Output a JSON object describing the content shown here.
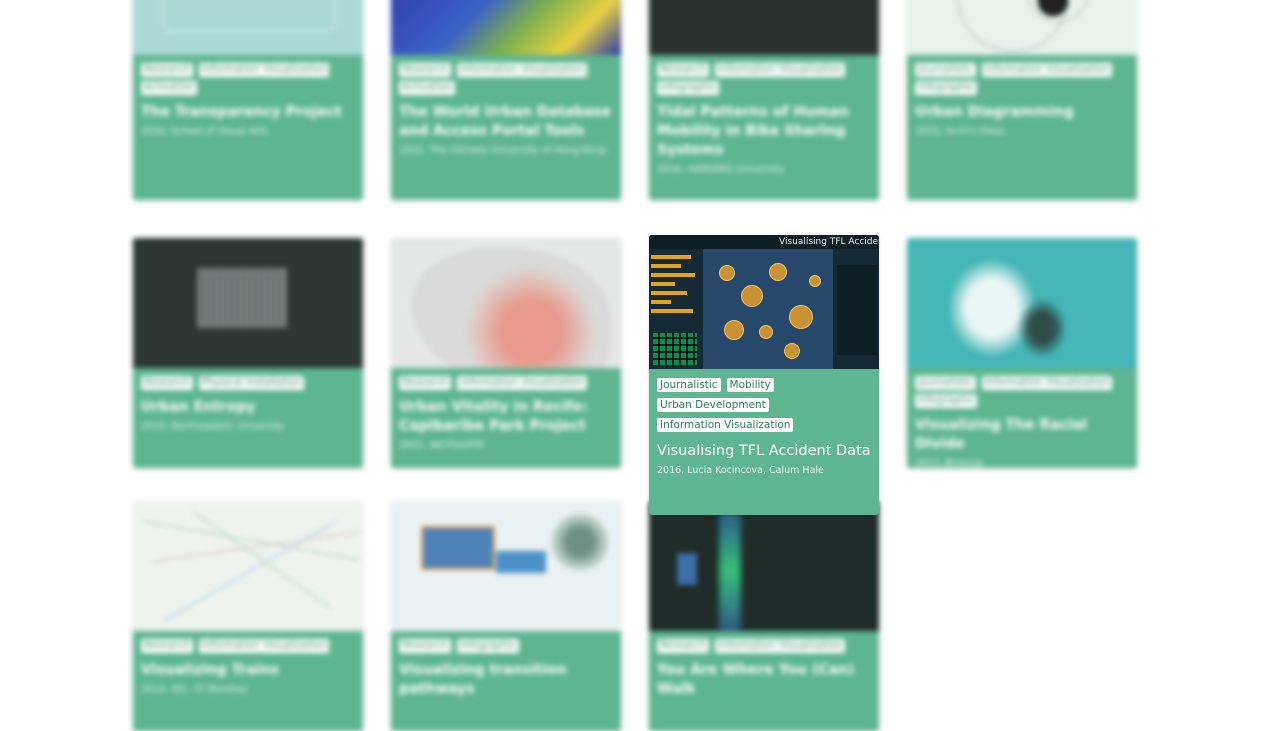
{
  "cards": [
    {
      "title": "The Transparency Project",
      "meta": "2016, School of Visual Arts",
      "tags": [
        "Research",
        "Information Visualization",
        "Activation"
      ]
    },
    {
      "title": "The World Urban Database and Access Portal Tools",
      "meta": "2015, The Chinese University of Hong Kong",
      "tags": [
        "Research",
        "Information Visualization",
        "Activation"
      ]
    },
    {
      "title": "Tidal Patterns of Human Mobility in Bike Sharing Systems",
      "meta": "2016, HARVARD University",
      "tags": [
        "Research",
        "Information Visualization",
        "Infographic"
      ]
    },
    {
      "title": "Urban Diagramming",
      "meta": "2015, Archi's Press",
      "tags": [
        "Journalistic",
        "Information Visualization",
        "Infographic"
      ]
    },
    {
      "title": "Urban Entropy",
      "meta": "2015, Northeastern University",
      "tags": [
        "Research",
        "Physical Installation"
      ]
    },
    {
      "title": "Urban Vitality in Recife: Capibaribe Park Project",
      "meta": "2015, INCITI/UFPE",
      "tags": [
        "Research",
        "Information Visualization"
      ]
    },
    {
      "title": "Visualising TFL Accident Data",
      "meta": "2016, Lucia Kocincova, Calum Hale",
      "tags": [
        "Journalistic",
        "Mobility",
        "Urban Development",
        "Information Visualization"
      ],
      "thumb_header": "Visualising TFL Accident D"
    },
    {
      "title": "Visualizing The Racial Divide",
      "meta": "2013, Biosoup",
      "tags": [
        "Journalistic",
        "Information Visualization",
        "Infographic"
      ]
    },
    {
      "title": "Visualizing Trains",
      "meta": "2014, IDC, IIT Bombay",
      "tags": [
        "Research",
        "Information Visualization"
      ]
    },
    {
      "title": "Visualizing transition pathways",
      "meta": "",
      "tags": [
        "Research",
        "Infographic"
      ]
    },
    {
      "title": "You Are Where You (Can) Walk",
      "meta": "",
      "tags": [
        "Research",
        "Information Visualization"
      ]
    }
  ]
}
